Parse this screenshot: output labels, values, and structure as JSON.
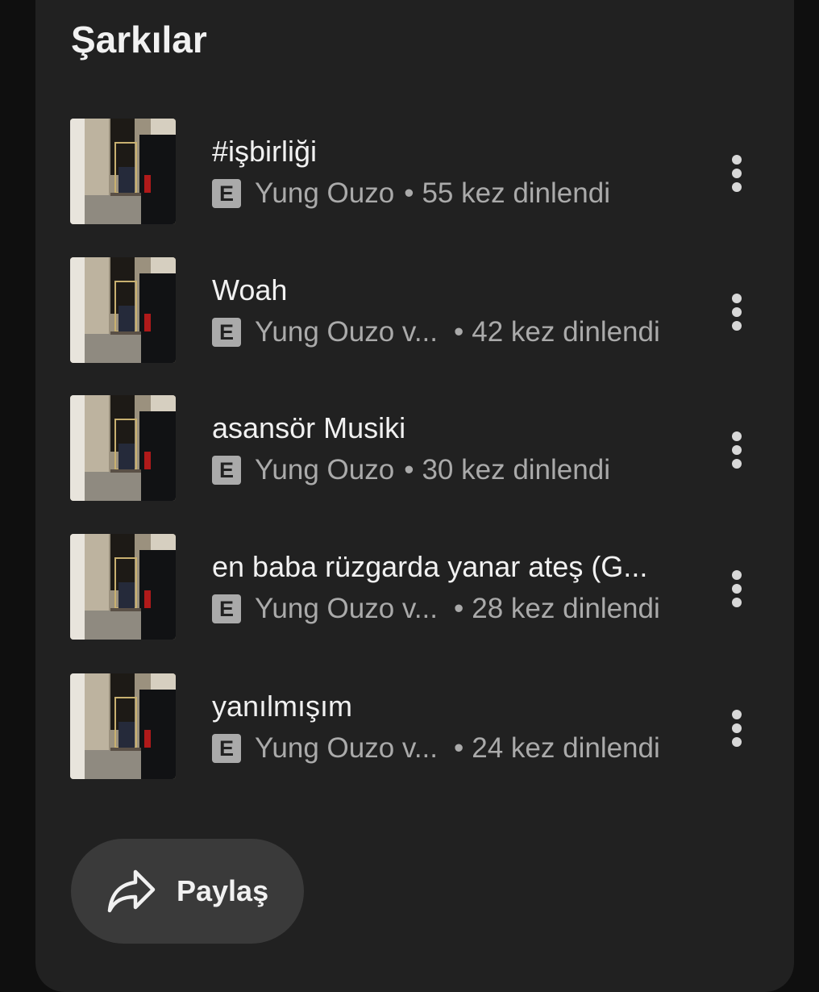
{
  "section": {
    "title": "Şarkılar"
  },
  "explicit_badge": "E",
  "separator": "•",
  "songs": [
    {
      "title": "#işbirliği",
      "artist": "Yung Ouzo",
      "plays": "55 kez dinlendi"
    },
    {
      "title": "Woah",
      "artist": "Yung Ouzo v...",
      "plays": "42 kez dinlendi"
    },
    {
      "title": "asansör Musiki",
      "artist": "Yung Ouzo",
      "plays": "30 kez dinlendi"
    },
    {
      "title": "en baba rüzgarda yanar ateş (G...",
      "artist": "Yung Ouzo v...",
      "plays": "28 kez dinlendi"
    },
    {
      "title": "yanılmışım",
      "artist": "Yung Ouzo v...",
      "plays": "24 kez dinlendi"
    }
  ],
  "icons": {
    "more": "more-vert-icon",
    "share": "share-arrow-icon",
    "explicit": "explicit-icon"
  },
  "share_button": {
    "label": "Paylaş"
  },
  "colors": {
    "background": "#0f0f0f",
    "card": "#212121",
    "text_primary": "#f1f1f1",
    "text_secondary": "#aaaaaa",
    "button": "#3a3a3a"
  }
}
